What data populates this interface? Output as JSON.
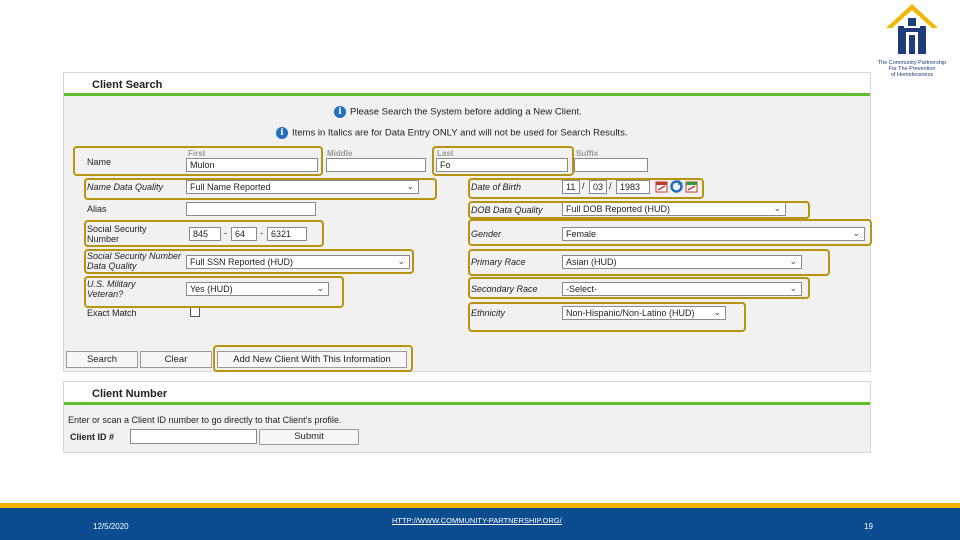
{
  "logo": {
    "line1": "The Community Partnership",
    "line2": "For The Prevention",
    "line3": "of Homelessness"
  },
  "client_search": {
    "title": "Client Search",
    "info_line1": "Please Search the System before adding a New Client.",
    "info_line2": "Items in Italics are for Data Entry ONLY and will not be used for Search Results.",
    "name": {
      "label": "Name",
      "first_label": "First",
      "middle_label": "Middle",
      "last_label": "Last",
      "suffix_label": "Suffix",
      "first_value": "Mulon",
      "middle_value": "",
      "last_value": "Fo",
      "suffix_value": ""
    },
    "name_data_quality": {
      "label": "Name Data Quality",
      "value": "Full Name Reported"
    },
    "alias": {
      "label": "Alias",
      "value": ""
    },
    "ssn": {
      "label": "Social Security Number",
      "part1": "845",
      "part2": "64",
      "part3": "6321"
    },
    "ssn_data_quality": {
      "label": "Social Security Number Data Quality",
      "value": "Full SSN Reported (HUD)"
    },
    "veteran": {
      "label": "U.S. Military Veteran?",
      "value": "Yes (HUD)"
    },
    "exact_match": {
      "label": "Exact Match"
    },
    "dob": {
      "label": "Date of Birth",
      "month": "11",
      "day": "03",
      "year": "1983"
    },
    "dob_data_quality": {
      "label": "DOB Data Quality",
      "value": "Full DOB Reported (HUD)"
    },
    "gender": {
      "label": "Gender",
      "value": "Female"
    },
    "primary_race": {
      "label": "Primary Race",
      "value": "Asian (HUD)"
    },
    "secondary_race": {
      "label": "Secondary Race",
      "value": "-Select-"
    },
    "ethnicity": {
      "label": "Ethnicity",
      "value": "Non-Hispanic/Non-Latino (HUD)"
    },
    "buttons": {
      "search": "Search",
      "clear": "Clear",
      "add_new": "Add New Client With This Information"
    }
  },
  "client_number": {
    "title": "Client Number",
    "instructions": "Enter or scan a Client ID number to go directly to that Client's profile.",
    "id_label": "Client ID #",
    "id_value": "",
    "submit": "Submit"
  },
  "footer": {
    "date": "12/5/2020",
    "url": "HTTP://WWW.COMMUNITY-PARTNERSHIP.ORG/",
    "page": "19"
  },
  "colors": {
    "accent_green": "#5cbf2a",
    "highlight_gold": "#b8930f",
    "footer_blue": "#0b4d8f",
    "footer_stripe": "#f2b705"
  }
}
